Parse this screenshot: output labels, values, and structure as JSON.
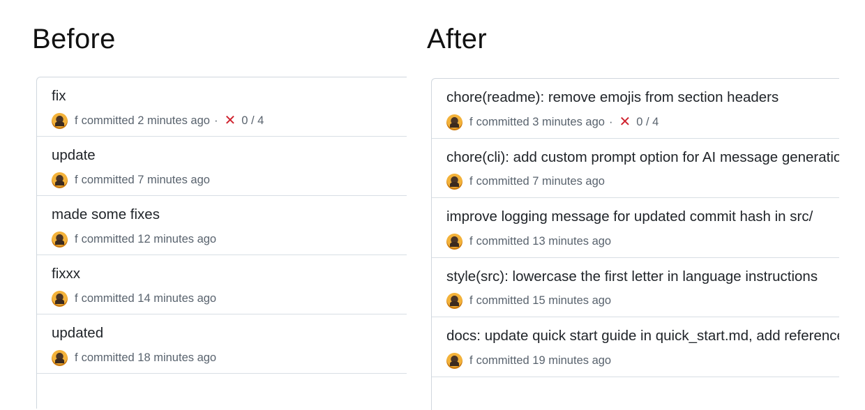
{
  "before": {
    "heading": "Before",
    "commits": [
      {
        "title": "fix",
        "author": "f",
        "time": "committed 2 minutes ago",
        "checks": "0 / 4"
      },
      {
        "title": "update",
        "author": "f",
        "time": "committed 7 minutes ago"
      },
      {
        "title": "made some fixes",
        "author": "f",
        "time": "committed 12 minutes ago"
      },
      {
        "title": "fixxx",
        "author": "f",
        "time": "committed 14 minutes ago"
      },
      {
        "title": "updated",
        "author": "f",
        "time": "committed 18 minutes ago"
      }
    ]
  },
  "after": {
    "heading": "After",
    "commits": [
      {
        "title": "chore(readme): remove emojis from section headers",
        "author": "f",
        "time": "committed 3 minutes ago",
        "checks": "0 / 4"
      },
      {
        "title": "chore(cli): add custom prompt option for AI message generation",
        "author": "f",
        "time": "committed 7 minutes ago"
      },
      {
        "title": "improve logging message for updated commit hash in src/",
        "author": "f",
        "time": "committed 13 minutes ago"
      },
      {
        "title": "style(src): lowercase the first letter in language instructions",
        "author": "f",
        "time": "committed 15 minutes ago"
      },
      {
        "title": "docs: update quick start guide in quick_start.md, add reference",
        "author": "f",
        "time": "committed 19 minutes ago"
      }
    ]
  },
  "icons": {
    "avatar": "user-avatar",
    "failed_check": "x-icon"
  },
  "colors": {
    "failed": "#cf222e",
    "muted": "#59636e",
    "border": "#d0d7de"
  }
}
